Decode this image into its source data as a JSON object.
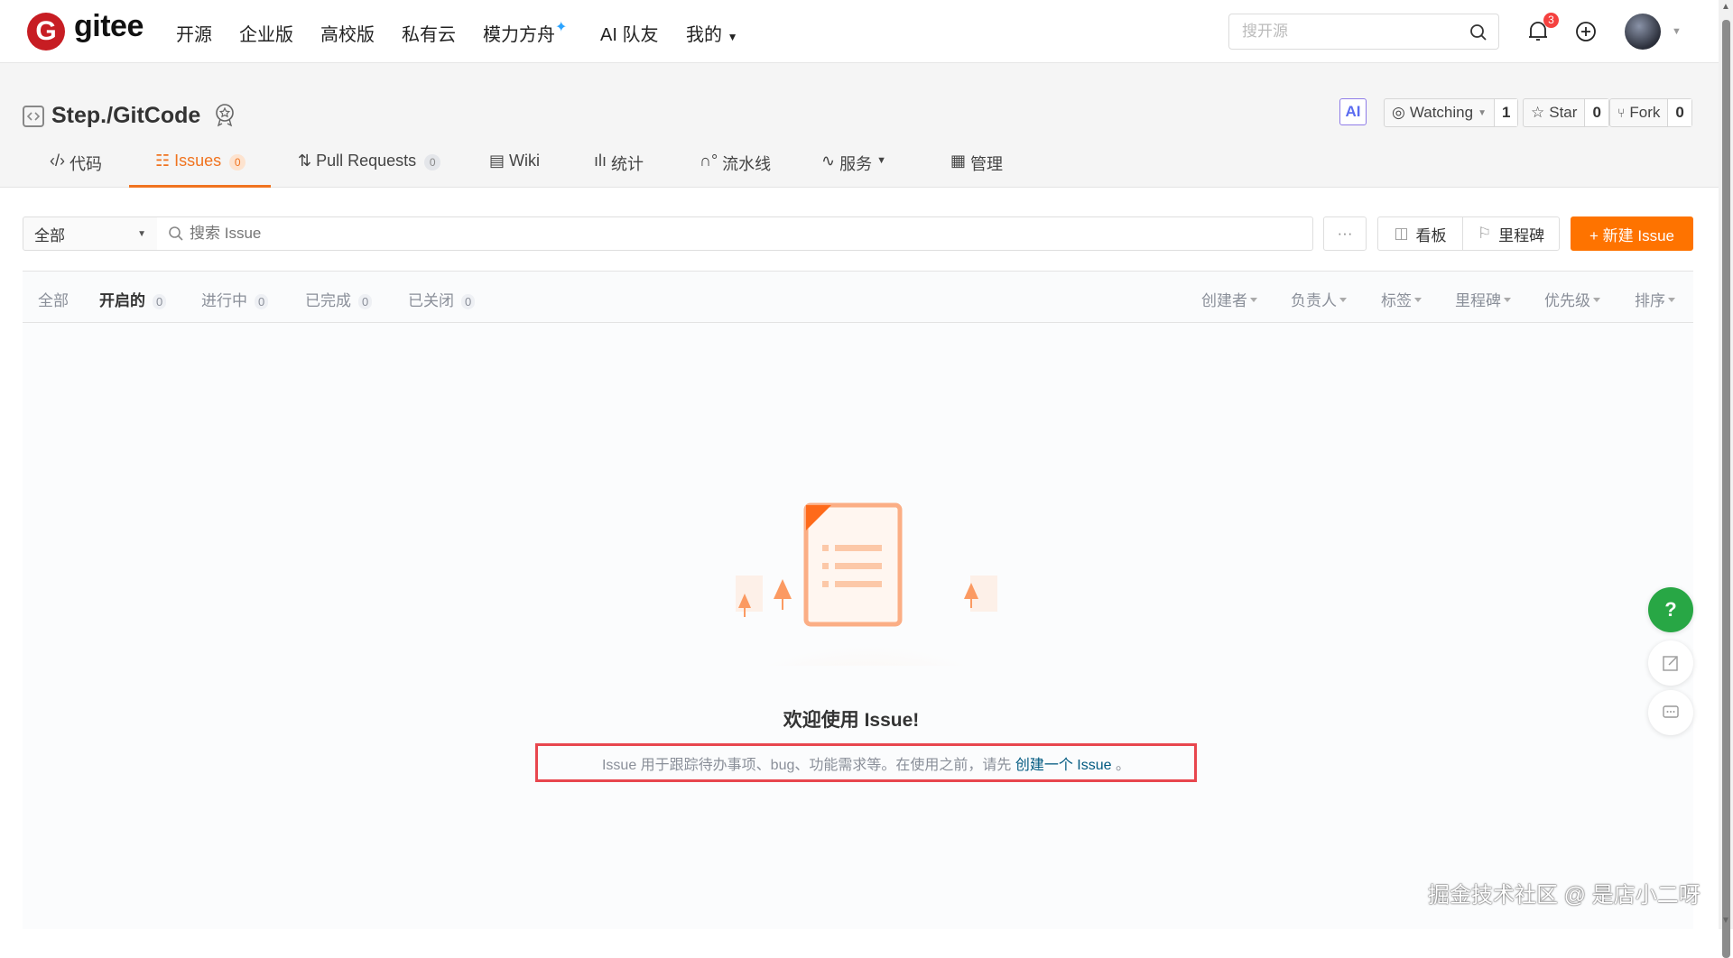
{
  "header": {
    "logo_text": "gitee",
    "nav": [
      "开源",
      "企业版",
      "高校版",
      "私有云",
      "模力方舟",
      "AI 队友",
      "我的"
    ],
    "search_placeholder": "搜开源",
    "notifications": "3"
  },
  "repo": {
    "title": "Step./GitCode",
    "ai_label": "AI",
    "watch_label": "Watching",
    "watch_count": "1",
    "star_label": "Star",
    "star_count": "0",
    "fork_label": "Fork",
    "fork_count": "0",
    "tabs": [
      {
        "label": "代码"
      },
      {
        "label": "Issues",
        "count": "0"
      },
      {
        "label": "Pull Requests",
        "count": "0"
      },
      {
        "label": "Wiki"
      },
      {
        "label": "统计"
      },
      {
        "label": "流水线"
      },
      {
        "label": "服务"
      },
      {
        "label": "管理"
      }
    ]
  },
  "filter": {
    "scope": "全部",
    "search_placeholder": "搜索 Issue",
    "more": "···",
    "board": "看板",
    "milestone": "里程碑",
    "new_issue": "+ 新建 Issue"
  },
  "status_tabs": [
    {
      "label": "全部"
    },
    {
      "label": "开启的",
      "count": "0"
    },
    {
      "label": "进行中",
      "count": "0"
    },
    {
      "label": "已完成",
      "count": "0"
    },
    {
      "label": "已关闭",
      "count": "0"
    }
  ],
  "right_filters": [
    "创建者",
    "负责人",
    "标签",
    "里程碑",
    "优先级",
    "排序"
  ],
  "empty": {
    "title": "欢迎使用 Issue!",
    "desc": "Issue 用于跟踪待办事项、bug、功能需求等。在使用之前，请先",
    "link": "创建一个 Issue",
    "end": "。"
  },
  "float": {
    "help": "?"
  },
  "watermark": "掘金技术社区 @ 是店小二呀",
  "colors": {
    "accent": "#f0731f",
    "primary_btn": "#fe7300",
    "link": "#005980",
    "highlight": "#e8464e"
  }
}
